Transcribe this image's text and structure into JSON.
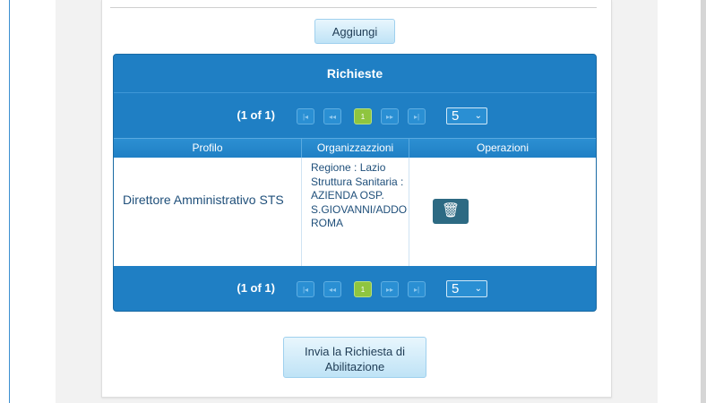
{
  "add_button": {
    "label": "Aggiungi"
  },
  "panel": {
    "title": "Richieste",
    "pager_top": {
      "count": "(1 of 1)",
      "first": "|◂",
      "prev": "◂◂",
      "page": "1",
      "next": "▸▸",
      "last": "▸|",
      "rows_per_page": "5",
      "caret": "⌄"
    },
    "pager_bottom": {
      "count": "(1 of 1)",
      "first": "|◂",
      "prev": "◂◂",
      "page": "1",
      "next": "▸▸",
      "last": "▸|",
      "rows_per_page": "5",
      "caret": "⌄"
    },
    "columns": [
      "Profilo",
      "Organizzazzioni",
      "Operazioni"
    ],
    "rows": [
      {
        "profilo": "Direttore Amministrativo STS",
        "organizzazioni": "Regione : Lazio Struttura Sanitaria : AZIENDA OSP. S.GIOVANNI/ADDO ROMA",
        "delete_icon": "🗑"
      }
    ]
  },
  "submit_button": {
    "label": "Invia la Richiesta di Abilitazione"
  },
  "colors": {
    "panel_blue": "#1f7fc4",
    "active_page": "#8fc53f",
    "delete_button": "#2d6a83"
  }
}
